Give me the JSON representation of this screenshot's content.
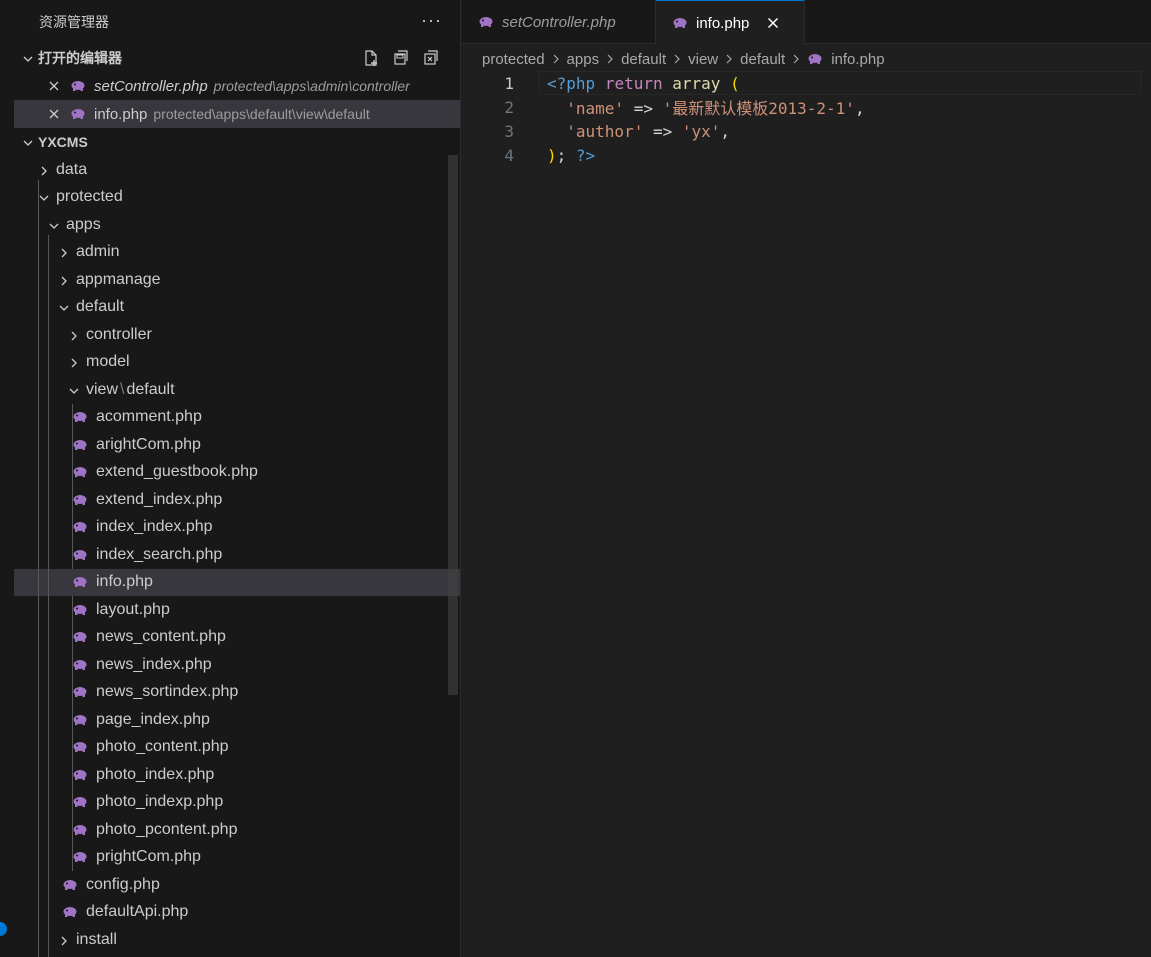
{
  "explorer": {
    "title": "资源管理器",
    "more_label": "···",
    "open_editors": {
      "header": "打开的编辑器",
      "items": [
        {
          "name": "setController.php",
          "path": "protected\\apps\\admin\\controller"
        },
        {
          "name": "info.php",
          "path": "protected\\apps\\default\\view\\default"
        }
      ]
    },
    "workspace": {
      "header": "YXCMS",
      "folders": {
        "data": "data",
        "protected": "protected",
        "apps": "apps",
        "admin": "admin",
        "appmanage": "appmanage",
        "default": "default",
        "controller": "controller",
        "model": "model",
        "view": "view",
        "view_sep": "\\",
        "view_default": "default",
        "install": "install"
      },
      "view_files": [
        "acomment.php",
        "arightCom.php",
        "extend_guestbook.php",
        "extend_index.php",
        "index_index.php",
        "index_search.php",
        "info.php",
        "layout.php",
        "news_content.php",
        "news_index.php",
        "news_sortindex.php",
        "page_index.php",
        "photo_content.php",
        "photo_index.php",
        "photo_indexp.php",
        "photo_pcontent.php",
        "prightCom.php"
      ],
      "default_files": [
        "config.php",
        "defaultApi.php"
      ]
    }
  },
  "tabs": [
    {
      "label": "setController.php"
    },
    {
      "label": "info.php"
    }
  ],
  "breadcrumb": [
    "protected",
    "apps",
    "default",
    "view",
    "default",
    "info.php"
  ],
  "code": {
    "line_numbers": [
      "1",
      "2",
      "3",
      "4"
    ],
    "line1": {
      "open": "<?php",
      "kw": "return",
      "fn": "array",
      "paren": "("
    },
    "line2": {
      "key": "'name'",
      "arrow": "=>",
      "value": "'最新默认模板2013-2-1'",
      "comma": ","
    },
    "line3": {
      "key": "'author'",
      "arrow": "=>",
      "value": "'yx'",
      "comma": ","
    },
    "line4": {
      "paren": ")",
      "semi": ";",
      "close": "?>"
    }
  },
  "colors": {
    "accent": "#0078d4",
    "php_icon": "#a074c4"
  }
}
